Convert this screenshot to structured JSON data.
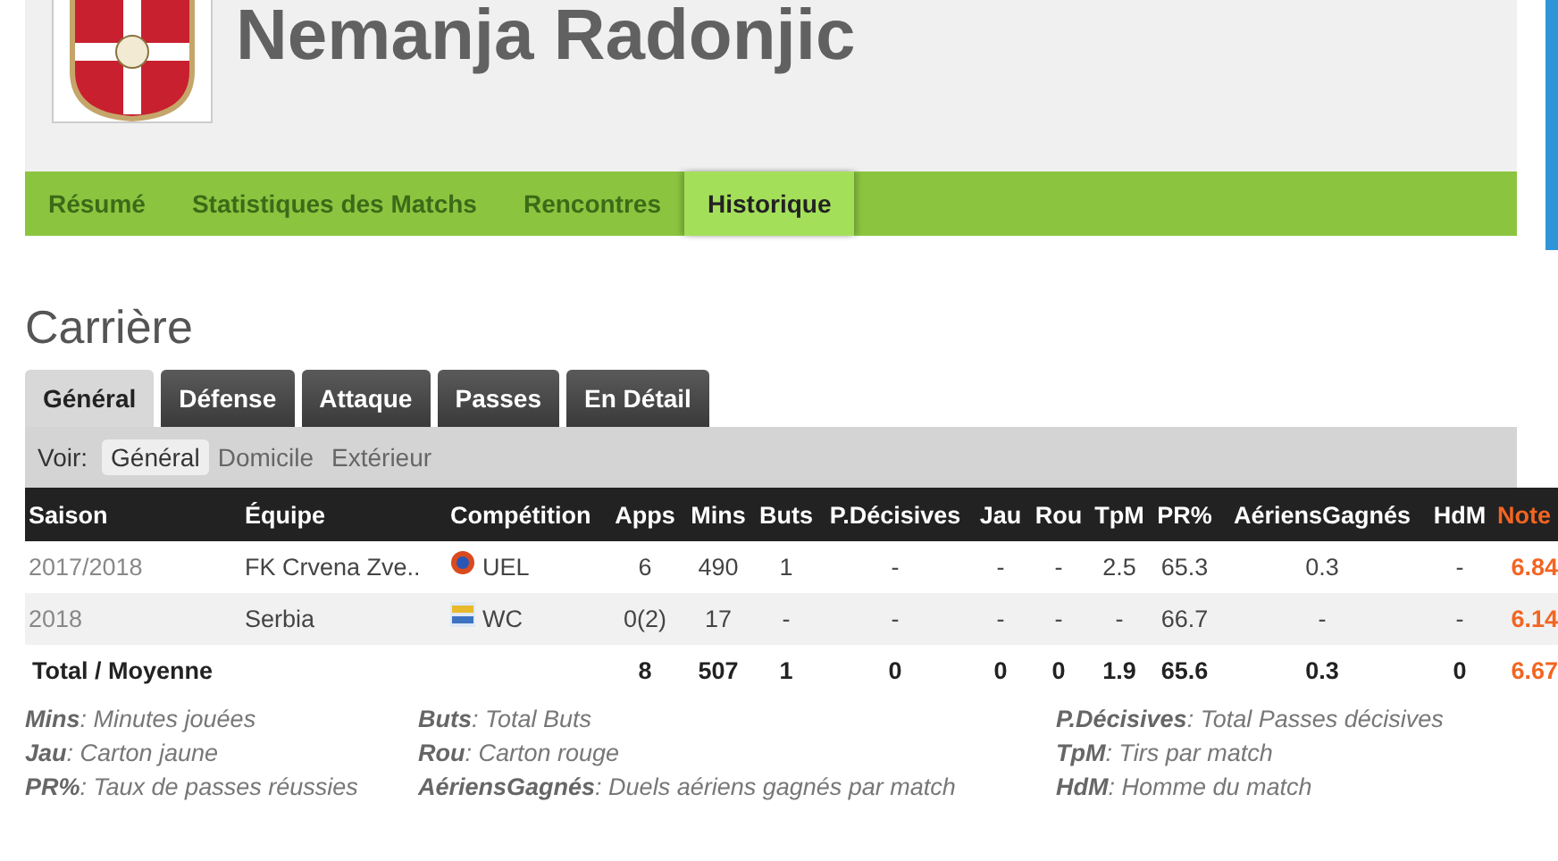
{
  "player": {
    "name": "Nemanja Radonjic"
  },
  "nav": [
    {
      "label": "Résumé",
      "selected": false
    },
    {
      "label": "Statistiques des Matchs",
      "selected": false
    },
    {
      "label": "Rencontres",
      "selected": false
    },
    {
      "label": "Historique",
      "selected": true
    }
  ],
  "section_title": "Carrière",
  "tabs": [
    {
      "label": "Général",
      "selected": true
    },
    {
      "label": "Défense",
      "selected": false
    },
    {
      "label": "Attaque",
      "selected": false
    },
    {
      "label": "Passes",
      "selected": false
    },
    {
      "label": "En Détail",
      "selected": false
    }
  ],
  "filter": {
    "label": "Voir:",
    "options": [
      {
        "label": "Général",
        "selected": true
      },
      {
        "label": "Domicile",
        "selected": false
      },
      {
        "label": "Extérieur",
        "selected": false
      }
    ]
  },
  "table": {
    "columns": [
      "Saison",
      "Équipe",
      "Compétition",
      "Apps",
      "Mins",
      "Buts",
      "P.Décisives",
      "Jau",
      "Rou",
      "TpM",
      "PR%",
      "AériensGagnés",
      "HdM",
      "Note"
    ],
    "rows": [
      {
        "season": "2017/2018",
        "team": "FK Crvena Zve..",
        "competition": {
          "label": "UEL",
          "kind": "uel"
        },
        "stats": [
          "6",
          "490",
          "1",
          "-",
          "-",
          "-",
          "2.5",
          "65.3",
          "0.3",
          "-"
        ],
        "rating": "6.84"
      },
      {
        "season": "2018",
        "team": "Serbia",
        "competition": {
          "label": "WC",
          "kind": "wc"
        },
        "stats": [
          "0(2)",
          "17",
          "-",
          "-",
          "-",
          "-",
          "-",
          "66.7",
          "-",
          "-"
        ],
        "rating": "6.14"
      }
    ],
    "total": {
      "label": "Total / Moyenne",
      "stats": [
        "8",
        "507",
        "1",
        "0",
        "0",
        "0",
        "1.9",
        "65.6",
        "0.3",
        "0"
      ],
      "rating": "6.67"
    }
  },
  "legend": [
    [
      "**Mins**: Minutes jouées",
      "**Jau**: Carton jaune",
      "**PR%**: Taux de passes réussies"
    ],
    [
      "**Buts**: Total Buts",
      "**Rou**: Carton rouge",
      "**AériensGagnés**: Duels aériens gagnés par match"
    ],
    [
      "**P.Décisives**: Total Passes décisives",
      "**TpM**: Tirs par match",
      "**HdM**: Homme du match"
    ]
  ]
}
